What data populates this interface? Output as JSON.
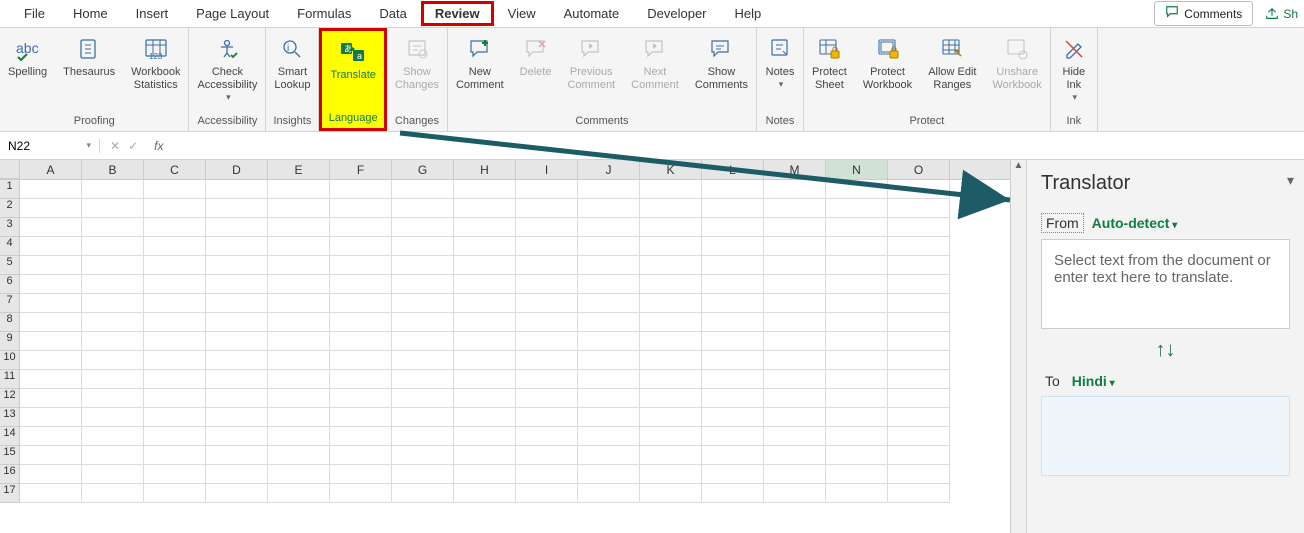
{
  "tabs": [
    "File",
    "Home",
    "Insert",
    "Page Layout",
    "Formulas",
    "Data",
    "Review",
    "View",
    "Automate",
    "Developer",
    "Help"
  ],
  "active_tab": "Review",
  "top_right": {
    "comments": "Comments",
    "share": "Sh"
  },
  "ribbon": {
    "proofing": {
      "label": "Proofing",
      "spelling": "Spelling",
      "thesaurus": "Thesaurus",
      "workbook_stats": "Workbook\nStatistics"
    },
    "accessibility": {
      "label": "Accessibility",
      "check": "Check\nAccessibility"
    },
    "insights": {
      "label": "Insights",
      "smart_lookup": "Smart\nLookup"
    },
    "language": {
      "label": "Language",
      "translate": "Translate"
    },
    "changes": {
      "label": "Changes",
      "show_changes": "Show\nChanges"
    },
    "comments": {
      "label": "Comments",
      "new": "New\nComment",
      "delete": "Delete",
      "previous": "Previous\nComment",
      "next": "Next\nComment",
      "show": "Show\nComments"
    },
    "notes": {
      "label": "Notes",
      "notes": "Notes"
    },
    "protect": {
      "label": "Protect",
      "sheet": "Protect\nSheet",
      "workbook": "Protect\nWorkbook",
      "ranges": "Allow Edit\nRanges",
      "unshare": "Unshare\nWorkbook"
    },
    "ink": {
      "label": "Ink",
      "hide": "Hide\nInk"
    }
  },
  "name_box": "N22",
  "columns": [
    "A",
    "B",
    "C",
    "D",
    "E",
    "F",
    "G",
    "H",
    "I",
    "J",
    "K",
    "L",
    "M",
    "N",
    "O"
  ],
  "rows": [
    1,
    2,
    3,
    4,
    5,
    6,
    7,
    8,
    9,
    10,
    11,
    12,
    13,
    14,
    15,
    16,
    17
  ],
  "selected_col": "N",
  "translator": {
    "title": "Translator",
    "from_label": "From",
    "from_lang": "Auto-detect",
    "placeholder": "Select text from the document or enter text here to translate.",
    "to_label": "To",
    "to_lang": "Hindi",
    "swap": "↑↓"
  }
}
